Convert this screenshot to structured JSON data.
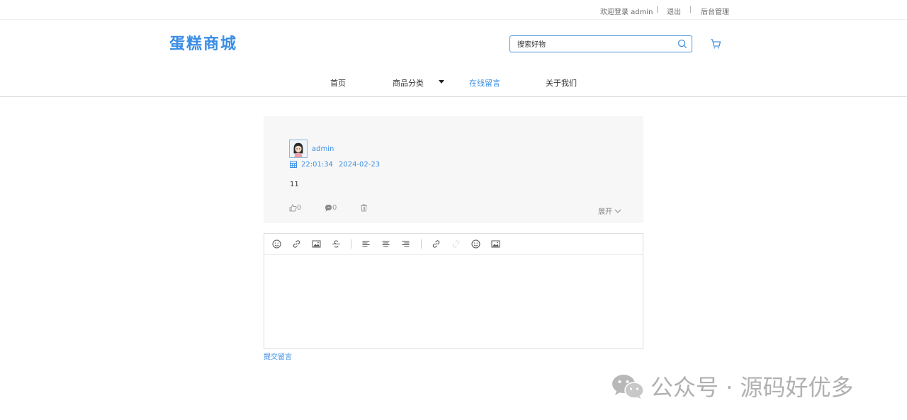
{
  "topbar": {
    "welcome": "欢迎登录 admin",
    "sep": "|",
    "logout": "退出",
    "admin": "后台管理"
  },
  "header": {
    "logo": "蛋糕商城",
    "search_placeholder": "搜索好物"
  },
  "nav": {
    "items": [
      "首页",
      "商品分类",
      "在线留言",
      "关于我们"
    ],
    "active": "在线留言"
  },
  "comment": {
    "username": "admin",
    "time": "22:01:34",
    "date": "2024-02-23",
    "content": "11",
    "likes": "0",
    "replies": "0",
    "expand": "展开"
  },
  "editor": {
    "submit": "提交留言"
  },
  "watermark": {
    "text": "公众号 · 源码好优多"
  },
  "colors": {
    "accent": "#3a8ee6",
    "card_bg": "#f7f7f7"
  }
}
